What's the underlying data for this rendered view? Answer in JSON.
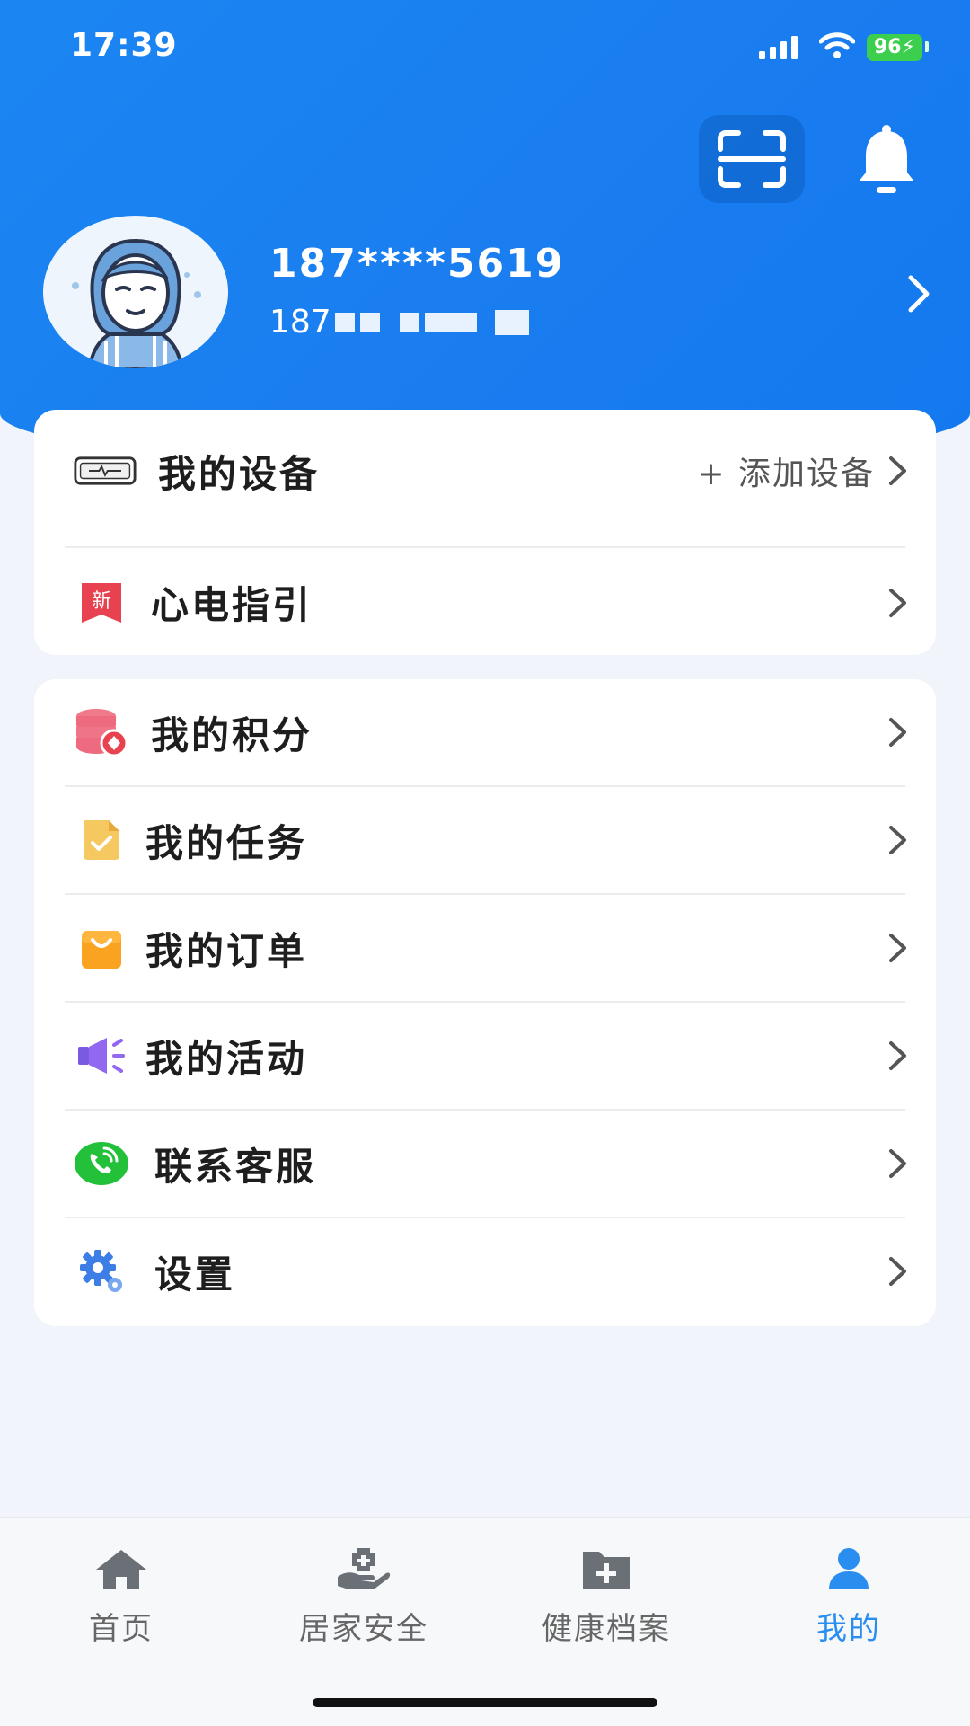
{
  "status_bar": {
    "time": "17:39",
    "battery": "96"
  },
  "profile": {
    "phone": "187****5619",
    "sub_prefix": "187"
  },
  "card1": {
    "my_devices": "我的设备",
    "add_device": "+ 添加设备",
    "ecg_guide": "心电指引",
    "new_badge": "新"
  },
  "menu": [
    {
      "label": "我的积分",
      "icon": "points-icon"
    },
    {
      "label": "我的任务",
      "icon": "task-icon"
    },
    {
      "label": "我的订单",
      "icon": "order-bag-icon"
    },
    {
      "label": "我的活动",
      "icon": "megaphone-icon"
    },
    {
      "label": "联系客服",
      "icon": "phone-service-icon"
    },
    {
      "label": "设置",
      "icon": "gear-icon"
    }
  ],
  "tabs": [
    {
      "label": "首页",
      "icon": "home-icon"
    },
    {
      "label": "居家安全",
      "icon": "hand-shield-icon"
    },
    {
      "label": "健康档案",
      "icon": "medical-folder-icon"
    },
    {
      "label": "我的",
      "icon": "user-icon",
      "active": true
    }
  ],
  "colors": {
    "primary": "#1a80f0",
    "active_tab": "#2a8ef0",
    "background": "#f1f5fb"
  }
}
